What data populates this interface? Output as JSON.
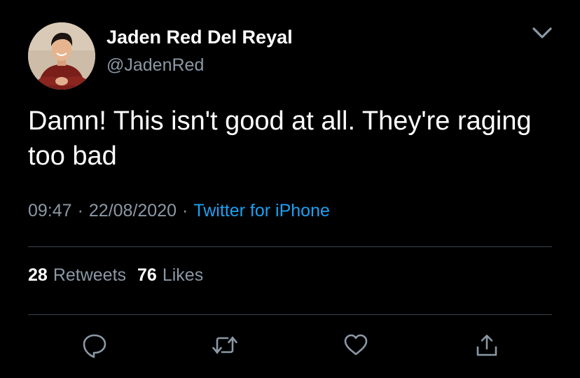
{
  "colors": {
    "background": "#000000",
    "text_primary": "#ffffff",
    "text_secondary": "#8b98a5",
    "accent": "#1da1f2",
    "divider": "#38444d"
  },
  "author": {
    "display_name": "Jaden Red Del Reyal",
    "handle": "@JadenRed",
    "avatar": "profile-photo"
  },
  "tweet": {
    "text": "Damn! This isn't good at all. They're raging too bad",
    "time": "09:47",
    "date": "22/08/2020",
    "source": "Twitter for iPhone",
    "separator": "·"
  },
  "stats": {
    "retweets_count": "28",
    "retweets_label": "Retweets",
    "likes_count": "76",
    "likes_label": "Likes"
  },
  "icons": {
    "more": "chevron-down-icon",
    "reply": "reply-icon",
    "retweet": "retweet-icon",
    "like": "heart-icon",
    "share": "share-icon"
  }
}
